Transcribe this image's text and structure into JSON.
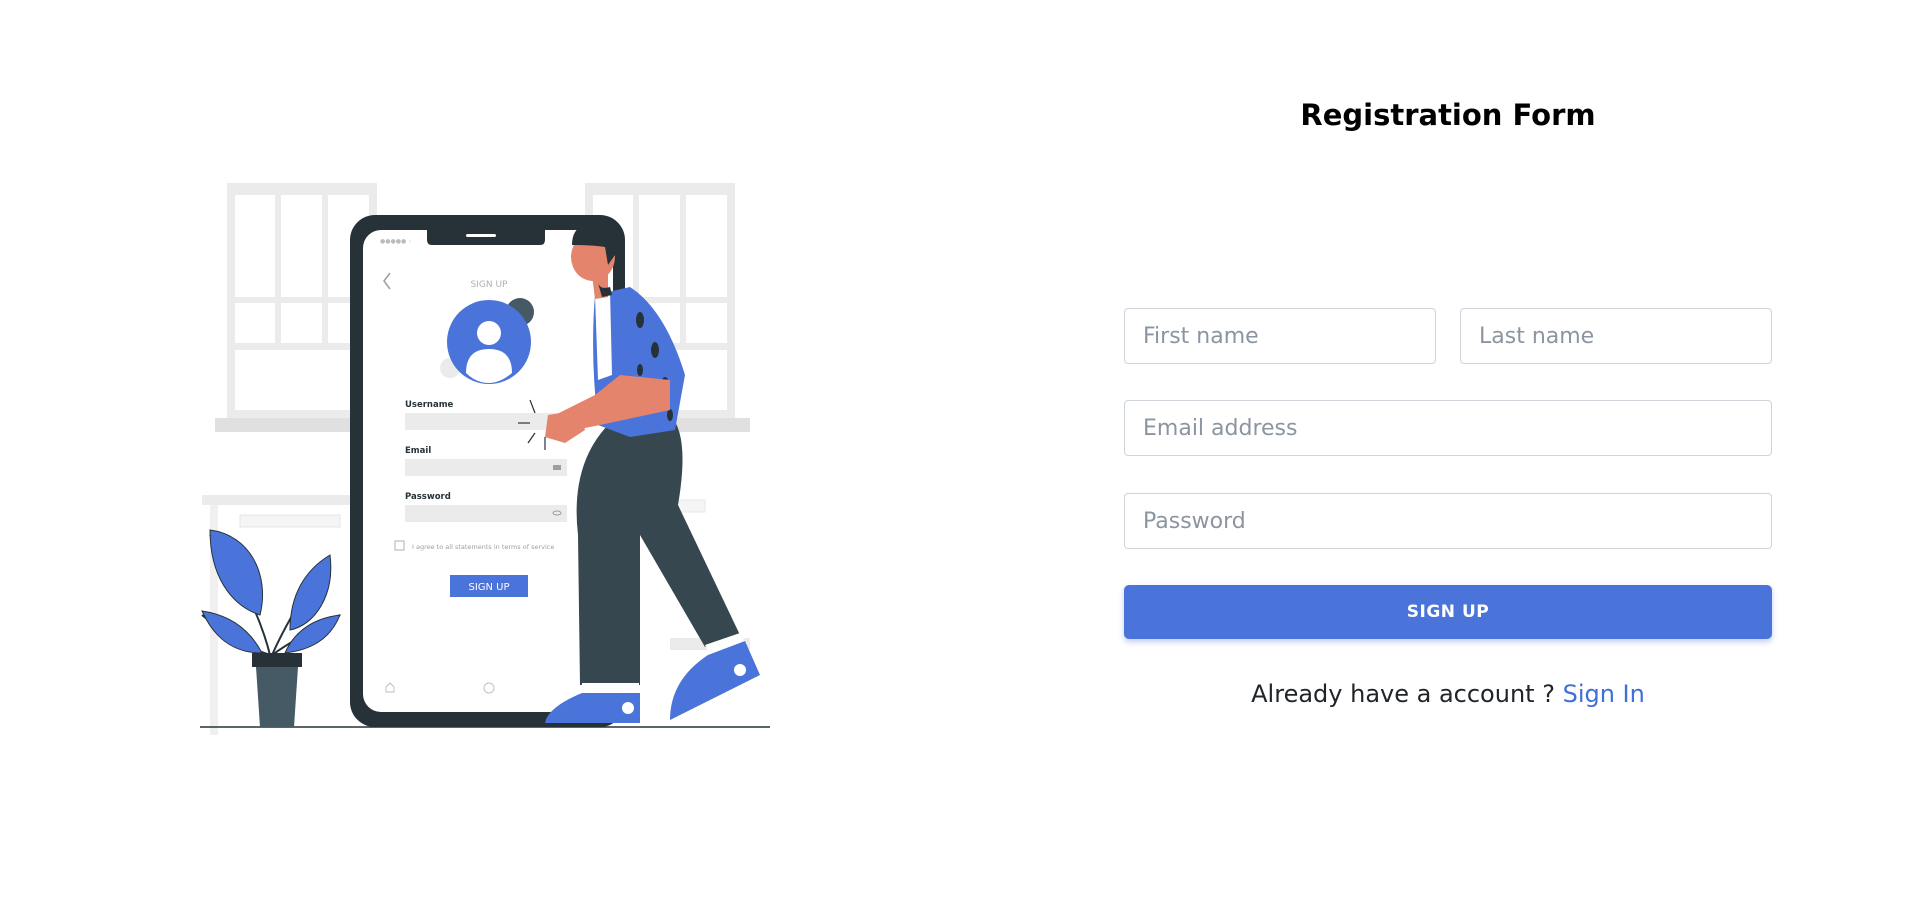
{
  "illustration": {
    "phone": {
      "header": "SIGN UP",
      "username_label": "Username",
      "email_label": "Email",
      "password_label": "Password",
      "terms_text": "I agree to all statements in terms of service",
      "button_label": "SIGN UP"
    }
  },
  "form": {
    "title": "Registration Form",
    "first_name": {
      "placeholder": "First name",
      "value": ""
    },
    "last_name": {
      "placeholder": "Last name",
      "value": ""
    },
    "email": {
      "placeholder": "Email address",
      "value": ""
    },
    "password": {
      "placeholder": "Password",
      "value": ""
    },
    "submit_label": "SIGN UP",
    "signin_prompt": "Already have a account ?",
    "signin_link": "Sign In"
  },
  "colors": {
    "accent": "#4a74d9",
    "link": "#3f6fd8",
    "phone_frame": "#263238",
    "pants": "#37474f"
  }
}
